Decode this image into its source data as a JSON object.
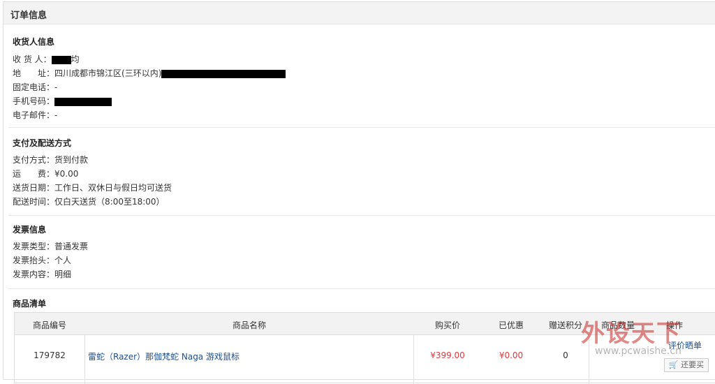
{
  "title": "订单信息",
  "receiver": {
    "heading": "收货人信息",
    "name_label": "收 货 人：",
    "name_suffix": "均",
    "address_label": "地　　址：",
    "address_value": "四川成都市锦江区(三环以内)",
    "phone_label": "固定电话：",
    "phone_value": "-",
    "mobile_label": "手机号码：",
    "email_label": "电子邮件：",
    "email_value": "-"
  },
  "payment": {
    "heading": "支付及配送方式",
    "method_label": "支付方式：",
    "method_value": "货到付款",
    "fee_label": "运　　费：",
    "fee_value": "¥0.00",
    "date_label": "送货日期：",
    "date_value": "工作日、双休日与假日均可送货",
    "time_label": "配送时间：",
    "time_value": "仅白天送货（8:00至18:00）"
  },
  "invoice": {
    "heading": "发票信息",
    "type_label": "发票类型：",
    "type_value": "普通发票",
    "header_label": "发票抬头：",
    "header_value": "个人",
    "content_label": "发票内容：",
    "content_value": "明细"
  },
  "goods": {
    "heading": "商品清单",
    "columns": [
      "商品编号",
      "商品名称",
      "购买价",
      "已优惠",
      "赠送积分",
      "商品数量",
      "操作"
    ],
    "rows": [
      {
        "id": "179782",
        "name": "雷蛇（Razer）那伽梵蛇 Naga 游戏鼠标",
        "price": "¥399.00",
        "discount": "¥0.00",
        "points": "0",
        "op_review": "评价晒单",
        "op_buy": "还要买"
      }
    ]
  },
  "watermark": {
    "text": "外设天下",
    "url": "www.pcwaishe.cn"
  }
}
